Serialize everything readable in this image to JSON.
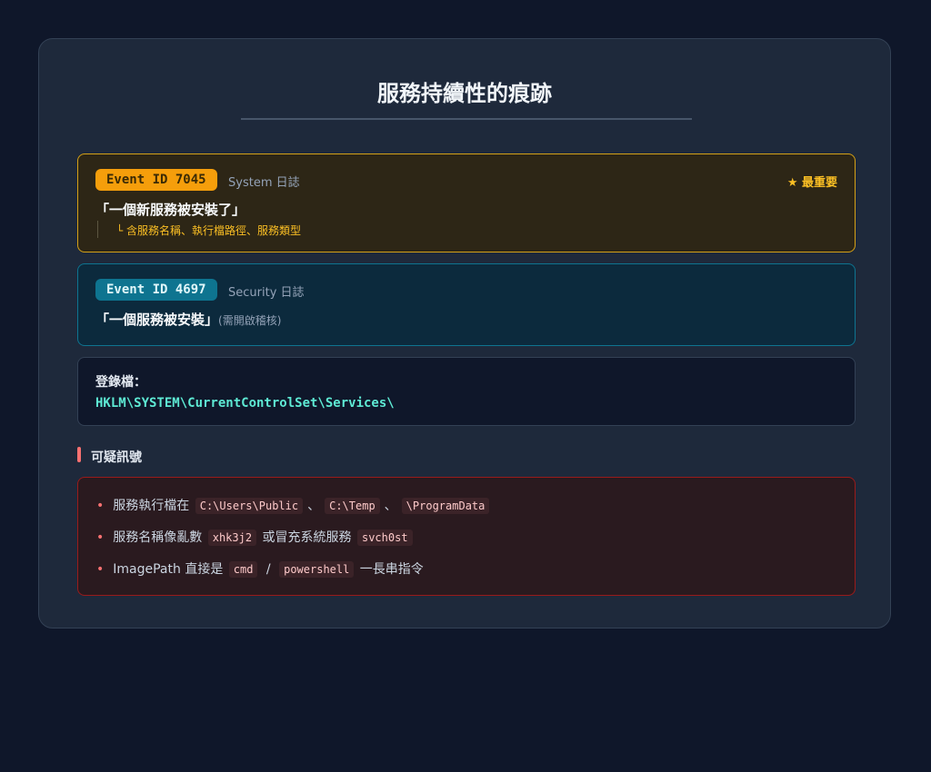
{
  "title": "服務持續性的痕跡",
  "event_7045": {
    "badge": "Event ID 7045",
    "source": "System 日誌",
    "priority": "★ 最重要",
    "quote": "「一個新服務被安裝了」",
    "detail": "└ 含服務名稱、執行檔路徑、服務類型"
  },
  "event_4697": {
    "badge": "Event ID 4697",
    "source": "Security 日誌",
    "quote": "「一個服務被安裝」",
    "note": "(需開啟稽核)"
  },
  "registry": {
    "label": "登錄檔：",
    "path": "HKLM\\SYSTEM\\CurrentControlSet\\Services\\"
  },
  "suspicious": {
    "heading": "可疑訊號",
    "item1": {
      "text": "服務執行檔在",
      "code1": "C:\\Users\\Public",
      "sep1": "、",
      "code2": "C:\\Temp",
      "sep2": "、",
      "code3": "\\ProgramData"
    },
    "item2": {
      "text1": "服務名稱像亂數",
      "code1": "xhk3j2",
      "text2": "或冒充系統服務",
      "code2": "svch0st"
    },
    "item3": {
      "text1": "ImagePath 直接是",
      "code1": "cmd",
      "sep": "/",
      "code2": "powershell",
      "text2": "一長串指令"
    }
  },
  "colors": {
    "background": "#0f172a",
    "card": "#1e293b",
    "yellow_accent": "#f59e0b",
    "cyan_accent": "#0e7490",
    "teal_text": "#5eead4",
    "red_accent": "#f87171"
  }
}
